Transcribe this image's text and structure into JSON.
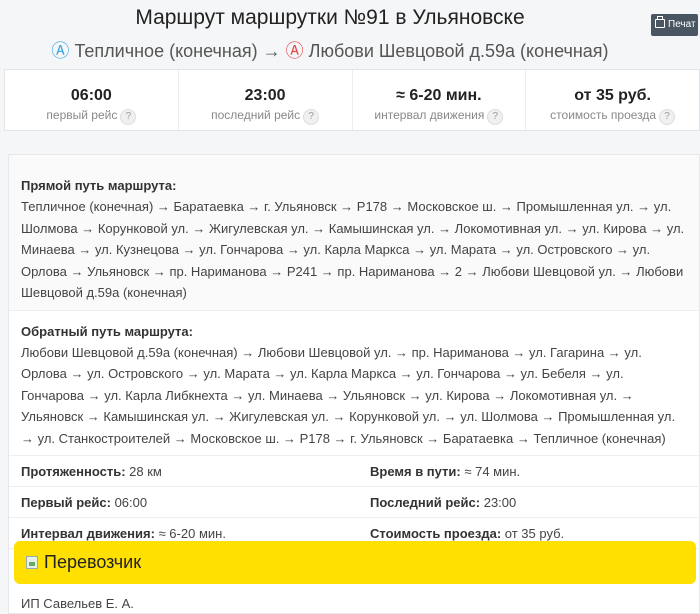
{
  "header": {
    "title": "Маршрут маршрутки №91 в Ульяновске",
    "stop_from": "Тепличное (конечная)",
    "stop_to": "Любови Шевцовой д.59а (конечная)",
    "arrow": "→",
    "marker_a": "Ⓐ",
    "marker_b": "Ⓐ",
    "print_label": "Печат",
    "print_icon": "printer-icon"
  },
  "stats": [
    {
      "value": "06:00",
      "label": "первый рейс"
    },
    {
      "value": "23:00",
      "label": "последний рейс"
    },
    {
      "value": "≈ 6-20 мин.",
      "label": "интервал движения"
    },
    {
      "value": "от 35 руб.",
      "label": "стоимость проезда"
    }
  ],
  "help_glyph": "?",
  "routes": {
    "forward": {
      "heading": "Прямой путь маршрута:",
      "text": "Тепличное (конечная) → Баратаевка → г. Ульяновск → Р178 → Московское ш. → Промышленная ул. → ул. Шолмова → Корунковой ул. → Жигулевская ул. → Камышинская ул. → Локомотивная ул. → ул. Кирова → ул. Минаева → ул. Кузнецова → ул. Гончарова → ул. Карла Маркса → ул. Марата → ул. Островского → ул. Орлова → Ульяновск → пр. Нариманова → Р241 → пр. Нариманова → 2 → Любови Шевцовой ул. → Любови Шевцовой д.59а (конечная)"
    },
    "reverse": {
      "heading": "Обратный путь маршрута:",
      "text": "Любови Шевцовой д.59а (конечная) → Любови Шевцовой ул. → пр. Нариманова → ул. Гагарина → ул. Орлова → ул. Островского → ул. Марата → ул. Карла Маркса → ул. Гончарова → ул. Бебеля → ул. Гончарова → ул. Карла Либкнехта → ул. Минаева → Ульяновск → ул. Кирова → Локомотивная ул. → Ульяновск → Камышинская ул. → Жигулевская ул. → Корунковой ул. → ул. Шолмова → Промышленная ул. → ул. Станкостроителей → Московское ш. → Р178 → г. Ульяновск → Баратаевка → Тепличное (конечная)"
    }
  },
  "info": [
    {
      "label": "Протяженность:",
      "value": "28 км"
    },
    {
      "label": "Время в пути:",
      "value": "≈ 74 мин."
    },
    {
      "label": "Первый рейс:",
      "value": "06:00"
    },
    {
      "label": "Последний рейс:",
      "value": "23:00"
    },
    {
      "label": "Интервал движения:",
      "value": "≈ 6-20 мин."
    },
    {
      "label": "Стоимость проезда:",
      "value": "от 35 руб."
    }
  ],
  "carrier": {
    "heading": "Перевозчик",
    "name": "ИП Савельев Е. А.",
    "image_icon": "broken-image-icon"
  },
  "colors": {
    "accent_yellow": "#ffe000",
    "marker_a": "#3aa7e0",
    "marker_b": "#e64848",
    "print_button": "#4a5563"
  }
}
